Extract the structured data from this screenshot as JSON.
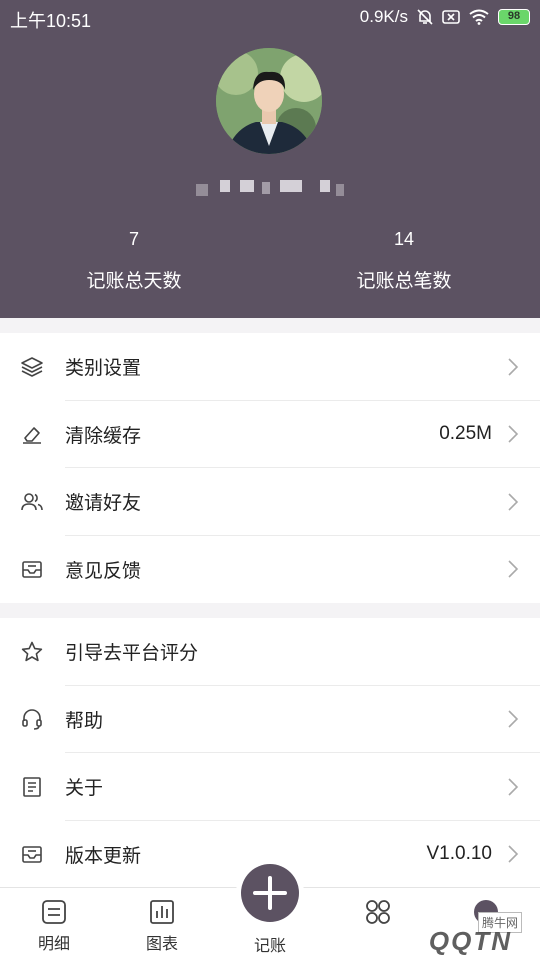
{
  "status_bar": {
    "time": "上午10:51",
    "speed": "0.9K/s",
    "battery": "98"
  },
  "profile": {
    "stats": [
      {
        "value": "7",
        "label": "记账总天数"
      },
      {
        "value": "14",
        "label": "记账总笔数"
      }
    ]
  },
  "settings": {
    "items": [
      {
        "label": "类别设置",
        "value": ""
      },
      {
        "label": "清除缓存",
        "value": "0.25M"
      },
      {
        "label": "邀请好友",
        "value": ""
      },
      {
        "label": "意见反馈",
        "value": ""
      }
    ]
  },
  "more": {
    "items": [
      {
        "label": "引导去平台评分",
        "value": ""
      },
      {
        "label": "帮助",
        "value": ""
      },
      {
        "label": "关于",
        "value": ""
      },
      {
        "label": "版本更新",
        "value": "V1.0.10"
      }
    ]
  },
  "tabbar": {
    "tabs": [
      {
        "label": "明细"
      },
      {
        "label": "图表"
      },
      {
        "label": "记账"
      }
    ]
  },
  "watermark": {
    "text": "腾牛网",
    "logo": "QQTN"
  },
  "colors": {
    "header_bg": "#5c5262",
    "accent": "#5c5262",
    "battery": "#6ad66a"
  }
}
